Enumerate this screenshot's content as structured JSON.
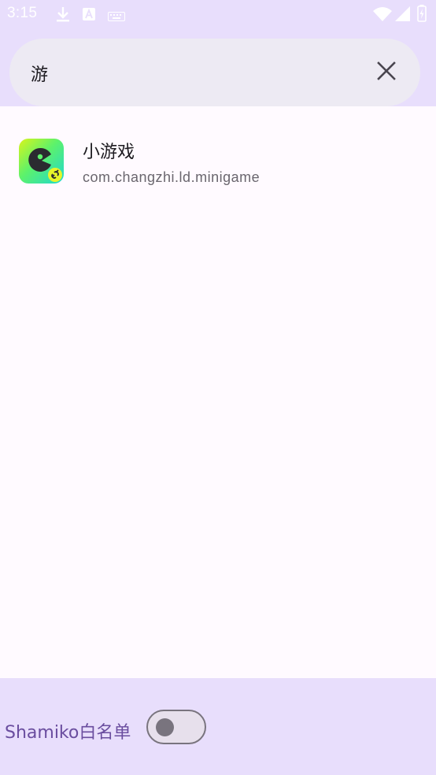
{
  "status_bar": {
    "time": "3:15",
    "left_icons": [
      "download-icon",
      "a-notification-icon",
      "keyboard-icon"
    ],
    "right_icons": [
      "wifi-icon",
      "signal-icon",
      "battery-charging-icon"
    ]
  },
  "search": {
    "query": "游",
    "clear_icon": "close-icon"
  },
  "results": [
    {
      "name": "小游戏",
      "package": "com.changzhi.ld.minigame",
      "icon": "minigame-app-icon"
    }
  ],
  "bottom": {
    "label": "Shamiko白名单",
    "toggle_state": "off"
  },
  "colors": {
    "accent_bg": "#e8defc",
    "search_bg": "#edeaf3",
    "list_bg": "#fffaff",
    "label_purple": "#6a4d9f",
    "toggle_outline": "#79747e"
  }
}
